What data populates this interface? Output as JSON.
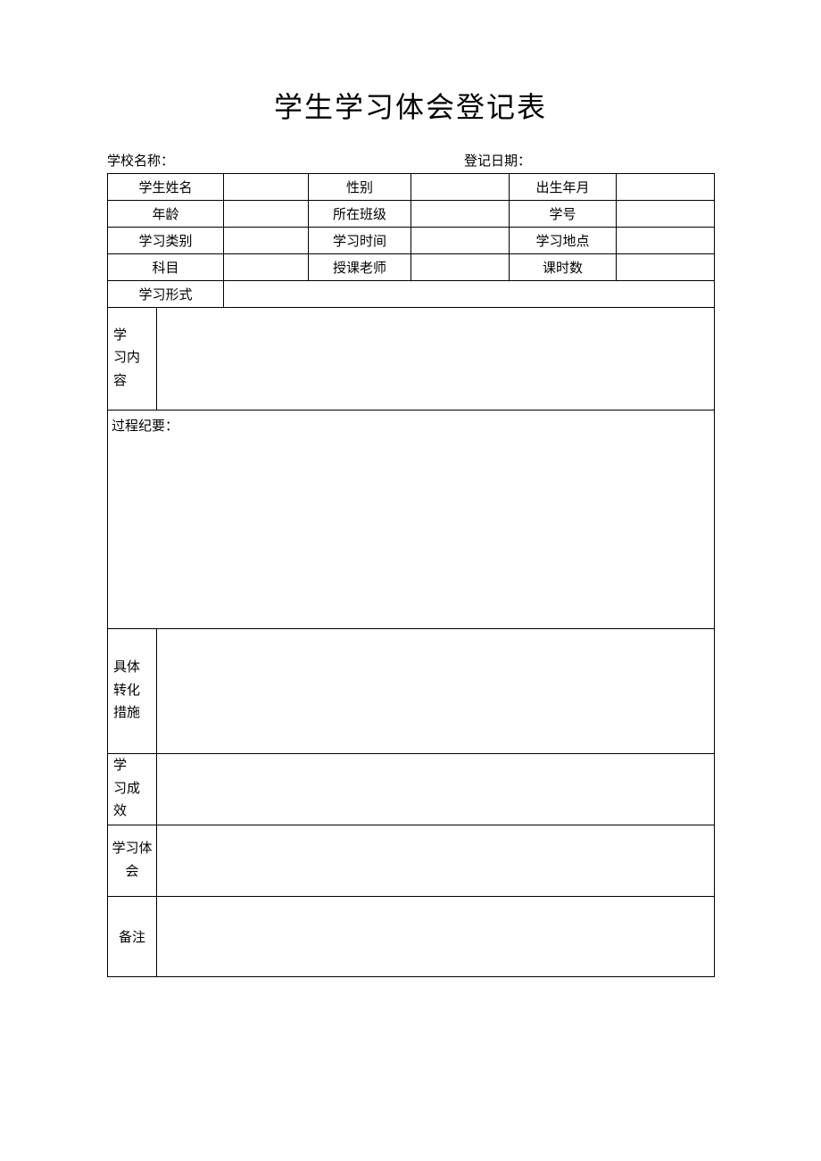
{
  "title": "学生学习体会登记表",
  "header": {
    "school_label": "学校名称：",
    "date_label": "登记日期："
  },
  "rows": {
    "r1": {
      "c1": "学生姓名",
      "c2": "",
      "c3": "性别",
      "c4": "",
      "c5": "出生年月",
      "c6": ""
    },
    "r2": {
      "c1": "年龄",
      "c2": "",
      "c3": "所在班级",
      "c4": "",
      "c5": "学号",
      "c6": ""
    },
    "r3": {
      "c1": "学习类别",
      "c2": "",
      "c3": "学习时间",
      "c4": "",
      "c5": "学习地点",
      "c6": ""
    },
    "r4": {
      "c1": "科目",
      "c2": "",
      "c3": "授课老师",
      "c4": "",
      "c5": "课时数",
      "c6": ""
    },
    "r5": {
      "label": "学习形式",
      "value": ""
    },
    "r6": {
      "label": "学　习内容",
      "value": ""
    },
    "r7": {
      "label": "过程纪要：",
      "value": ""
    },
    "r8": {
      "label": "具体转化措施",
      "value": ""
    },
    "r9": {
      "label": "学　习成效",
      "value": ""
    },
    "r10": {
      "label": "学习体会",
      "value": ""
    },
    "r11": {
      "label": "备注",
      "value": ""
    }
  }
}
